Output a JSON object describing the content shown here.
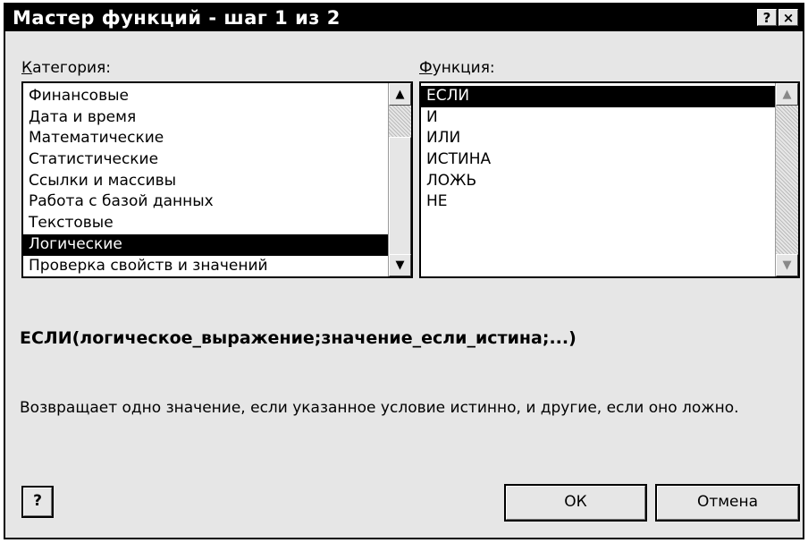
{
  "window": {
    "title": "Мастер функций - шаг 1 из 2",
    "help_button": "?",
    "close_button": "×"
  },
  "category": {
    "label_mnemonic": "К",
    "label_rest": "атегория:",
    "items": [
      "Финансовые",
      "Дата и время",
      "Математические",
      "Статистические",
      "Ссылки и массивы",
      "Работа с базой данных",
      "Текстовые",
      "Логические",
      "Проверка свойств и значений"
    ],
    "selected": "Логические"
  },
  "function": {
    "label_mnemonic": "Ф",
    "label_rest": "ункция:",
    "items": [
      "ЕСЛИ",
      "И",
      "ИЛИ",
      "ИСТИНА",
      "ЛОЖЬ",
      "НЕ"
    ],
    "selected": "ЕСЛИ"
  },
  "syntax": "ЕСЛИ(логическое_выражение;значение_если_истина;...)",
  "description": "Возвращает одно значение, если указанное условие истинно, и другие, если оно ложно.",
  "buttons": {
    "help": "?",
    "ok": "ОК",
    "cancel": "Отмена"
  },
  "icons": {
    "scroll_up": "▲",
    "scroll_down": "▼"
  }
}
